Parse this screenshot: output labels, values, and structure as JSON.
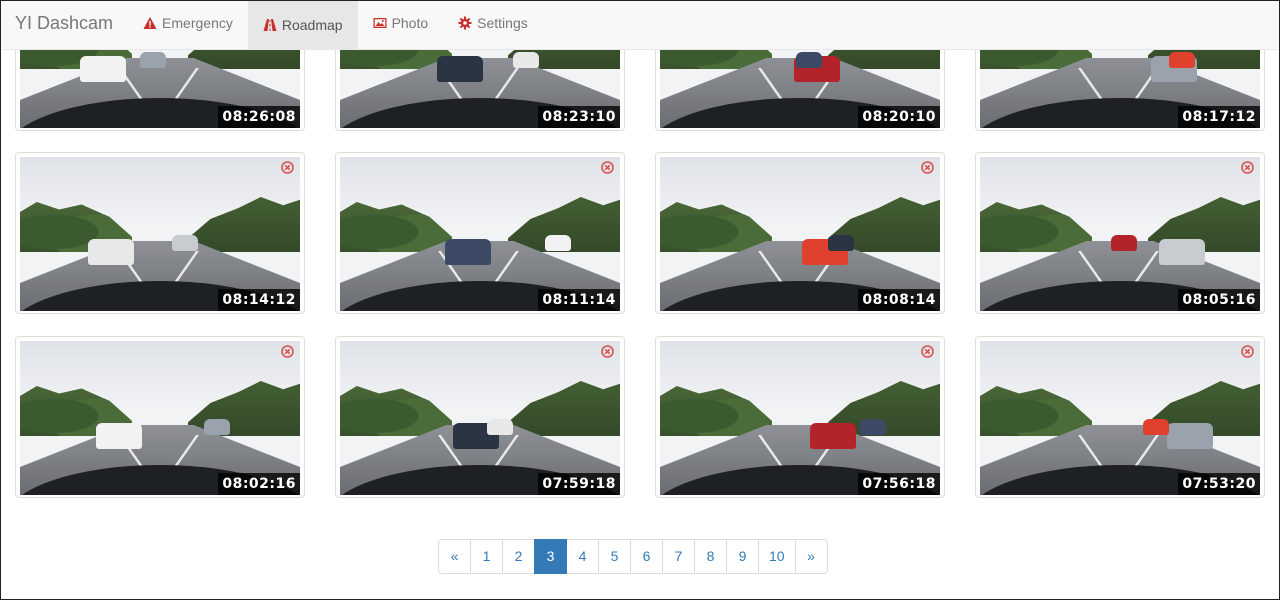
{
  "navbar": {
    "brand": "YI Dashcam",
    "items": [
      {
        "label": "Emergency",
        "icon": "warning-icon",
        "active": false
      },
      {
        "label": "Roadmap",
        "icon": "road-icon",
        "active": true
      },
      {
        "label": "Photo",
        "icon": "picture-icon",
        "active": false
      },
      {
        "label": "Settings",
        "icon": "gear-icon",
        "active": false
      }
    ],
    "accent_color": "#c9302c"
  },
  "thumbnails": [
    {
      "time": "08:26:08"
    },
    {
      "time": "08:23:10"
    },
    {
      "time": "08:20:10"
    },
    {
      "time": "08:17:12"
    },
    {
      "time": "08:14:12"
    },
    {
      "time": "08:11:14"
    },
    {
      "time": "08:08:14"
    },
    {
      "time": "08:05:16"
    },
    {
      "time": "08:02:16"
    },
    {
      "time": "07:59:18"
    },
    {
      "time": "07:56:18"
    },
    {
      "time": "07:53:20"
    }
  ],
  "pagination": {
    "prev": "«",
    "next": "»",
    "pages": [
      "1",
      "2",
      "3",
      "4",
      "5",
      "6",
      "7",
      "8",
      "9",
      "10"
    ],
    "current": "3",
    "active_color": "#337ab7"
  }
}
